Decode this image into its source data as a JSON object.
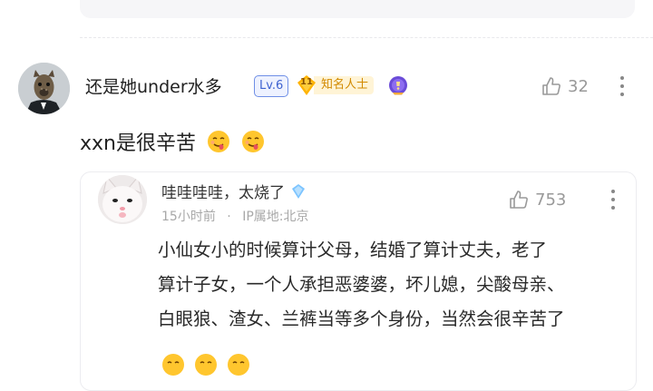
{
  "comment": {
    "username": "还是她under水多",
    "level_badge": "Lv.6",
    "fame_badge": {
      "number": "11",
      "label": "知名人士"
    },
    "likes": "32",
    "text": "xxn是很辛苦",
    "emojis": [
      "drool-face-emoji",
      "drool-face-emoji"
    ]
  },
  "reply": {
    "username": "哇哇哇哇，太烧了",
    "time": "15小时前",
    "ip": "IP属地:北京",
    "likes": "753",
    "body_lines": [
      "小仙女小的时候算计父母，结婚了算计丈夫，老了",
      "算计子女，一个人承担恶婆婆，坏儿媳，尖酸母亲、",
      "白眼狼、渣女、兰裤当等多个身份，当然会很辛苦了"
    ],
    "emojis": [
      "smirk-face-emoji",
      "smirk-face-emoji",
      "smirk-face-emoji"
    ]
  },
  "colors": {
    "level_badge": "#3e63d0",
    "fame_badge": "#d28a00",
    "meta_text": "#a8a8a8"
  }
}
